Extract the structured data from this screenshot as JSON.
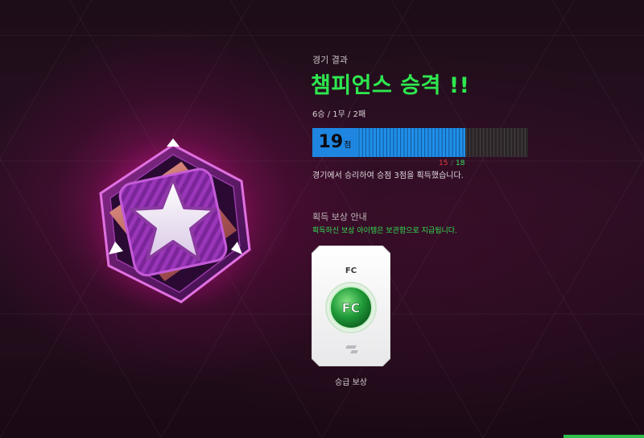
{
  "header": {
    "subtitle": "경기 결과",
    "headline": "챔피언스 승격 !!"
  },
  "stats": {
    "record": "6승 / 1무 / 2패",
    "points_value": "19",
    "points_unit": "점",
    "marker_red": "15",
    "marker_green": "18",
    "description": "경기에서 승리하여 승점 3점을 획득했습니다.",
    "progress_fraction": 0.71
  },
  "reward": {
    "section_title": "획득 보상 안내",
    "note": "획득하신 보상 아이템은 보관함으로 지급됩니다.",
    "card_title": "FC",
    "coin_text": "FC",
    "card_label": "승급 보상"
  },
  "colors": {
    "headline": "#2ee84e",
    "bar_fill": "#1f8fe8",
    "emblem_glow": "#d6188c",
    "marker_red": "#e23a3a",
    "marker_green": "#38e060"
  },
  "icons": {
    "emblem": "star-badge-icon",
    "coin": "fc-coin-icon",
    "card_logo": "fc-logo-icon"
  }
}
